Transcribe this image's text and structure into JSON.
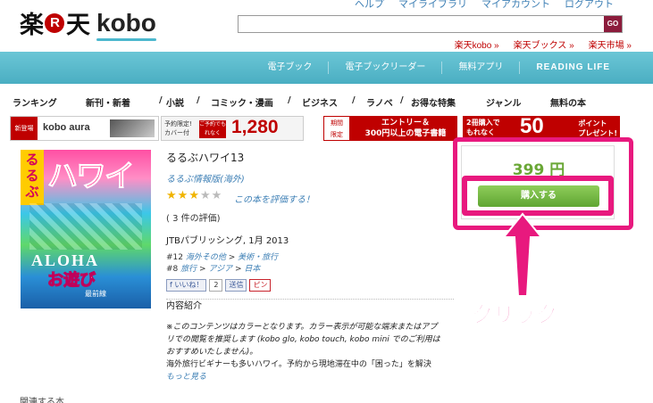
{
  "header": {
    "logo_rakuten_a": "楽",
    "logo_r": "R",
    "logo_rakuten_b": "天",
    "logo_kobo": "kobo",
    "top_links": [
      "ヘルプ",
      "マイライブラリ",
      "マイアカウント",
      "ログアウト"
    ],
    "search_placeholder": "",
    "search_button": "GO",
    "store_links": [
      "楽天kobo »",
      "楽天ブックス »",
      "楽天市場 »"
    ]
  },
  "teal_nav": [
    "電子ブック",
    "電子ブックリーダー",
    "無料アプリ",
    "READING LIFE"
  ],
  "category_nav": [
    "ランキング",
    "新刊・新着",
    "/",
    "小説",
    "/",
    "コミック・漫画",
    "/",
    "ビジネス",
    "/",
    "ラノベ",
    "/",
    "お得な特集",
    "ジャンル",
    "無料の本"
  ],
  "banners": {
    "b1_tag": "新登場",
    "b1_text": "kobo aura",
    "b2_small_1": "予約限定!",
    "b2_small_2": "カバー付",
    "b2_red": "ご予約でもれなく",
    "b2_num": "1,280",
    "b3_tag_1": "期間",
    "b3_tag_2": "限定",
    "b3_text_1": "エントリー＆",
    "b3_text_2": "300円以上の電子書籍",
    "b4_text_1": "2冊購入で",
    "b4_text_2": "もれなく",
    "b4_num": "50",
    "b4_pt_1": "ポイント",
    "b4_pt_2": "プレゼント!"
  },
  "cover": {
    "badge": "るるぶ",
    "title": "ハワイ",
    "aloha": "ALOHA",
    "play": "お遊び",
    "small": "最前線"
  },
  "book": {
    "title": "るるぶハワイ13",
    "author": "るるぶ情報版(海外)",
    "rating": 3,
    "rating_max": 5,
    "star_on": "★",
    "star_off": "★",
    "rate_link": "この本を評価する！",
    "reviews": "( 3 件の評価)",
    "publisher": "JTBパブリッシング, 1月 2013",
    "rank1_num": "#12",
    "rank1_a": "海外その他",
    "rank1_sep": " > ",
    "rank1_b": "美術・旅行",
    "rank2_num": "#8",
    "rank2_a": "旅行",
    "rank2_b": "アジア",
    "rank2_c": "日本",
    "like_label": "いいね！",
    "like_count": "2",
    "send_label": "送信",
    "pin_label": "ピン",
    "desc_heading": "内容紹介",
    "desc_italic": "※このコンテンツはカラーとなります。カラー表示が可能な端末またはアプリでの閲覧を推奨します (kobo glo, kobo touch, kobo mini でのご利用はおすすめいたしません)。",
    "desc_text": "海外旅行ビギナーも多いハワイ。予約から現地滞在中の「困った」を解決",
    "more_link": "もっと見る"
  },
  "purchase": {
    "price": "399 円",
    "buy_label": "購入する"
  },
  "annotation": {
    "click_label": "クリック"
  },
  "related": "関連する本"
}
